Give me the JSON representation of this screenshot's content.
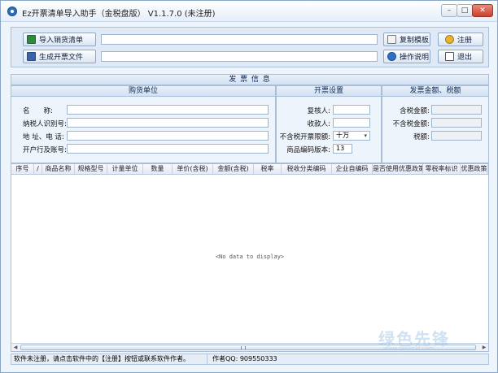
{
  "window": {
    "title": "Ez开票清单导入助手（金税盘版） V1.1.7.0 (未注册)",
    "buttons": {
      "minimize": "–",
      "maximize": "□",
      "close": "✕"
    }
  },
  "toolbar": {
    "import_label": "导入销货清单",
    "generate_label": "生成开票文件",
    "copy_template_label": "复制模板",
    "register_label": "注册",
    "help_label": "操作说明",
    "exit_label": "退出",
    "import_path_value": "",
    "output_path_value": ""
  },
  "invoice_info": {
    "title": "发 票 信 息",
    "buyer": {
      "title": "购货单位",
      "name_label": "名　　称:",
      "tax_id_label": "纳税人识别号:",
      "address_label": "地 址、电 话:",
      "bank_label": "开户行及账号:"
    },
    "settings": {
      "title": "开票设置",
      "reviewer_label": "复核人:",
      "payee_label": "收款人:",
      "limit_label": "不含税开票限额:",
      "limit_value": "十万",
      "code_version_label": "商品编码版本:",
      "code_version_value": "13"
    },
    "amounts": {
      "title": "发票金额、税额",
      "incl_tax_label": "含税金额:",
      "excl_tax_label": "不含税金额:",
      "tax_label": "税额:"
    }
  },
  "grid": {
    "columns": [
      "序号",
      "/",
      "商品名称",
      "规格型号",
      "计量单位",
      "数量",
      "单价(含税)",
      "金额(含税)",
      "税率",
      "税收分类编码",
      "企业自编码",
      "是否使用优惠政策",
      "零税率标识",
      "优惠政策"
    ],
    "empty_text": "<No data to display>"
  },
  "status": {
    "left": "软件未注册，请点击软件中的【注册】按钮或联系软件作者。",
    "right": "作者QQ: 909550333"
  },
  "watermark": {
    "main": "绿色先锋",
    "sub": "www.greenxf.com"
  }
}
